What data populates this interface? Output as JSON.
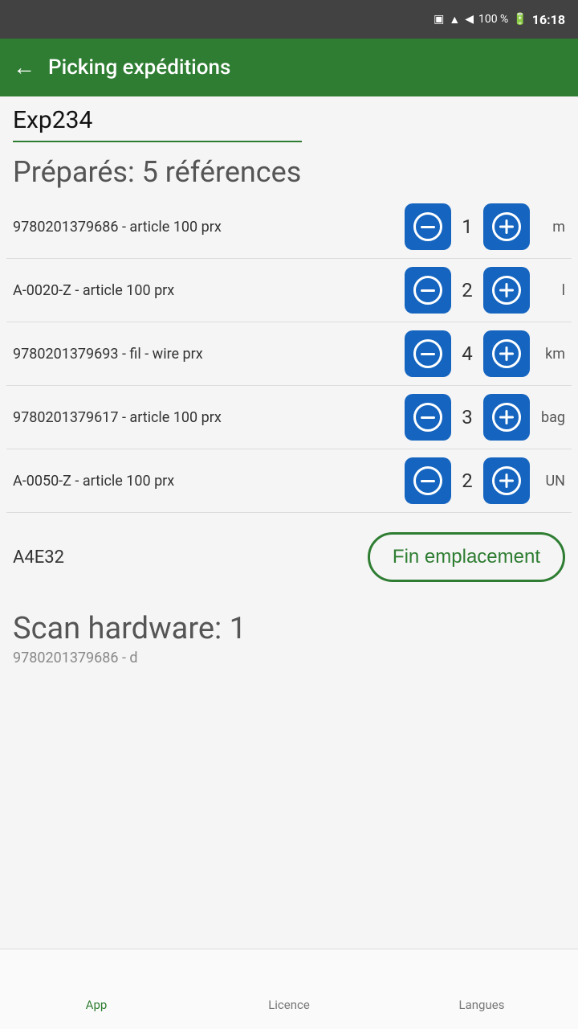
{
  "statusBar": {
    "battery": "100 %",
    "time": "16:18"
  },
  "header": {
    "backLabel": "←",
    "title": "Picking expéditions"
  },
  "expeditionId": "Exp234",
  "preparesTitle": "Préparés: 5 références",
  "items": [
    {
      "id": "item-1",
      "label": "9780201379686 - article 100 prx",
      "qty": 1,
      "unit": "m"
    },
    {
      "id": "item-2",
      "label": "A-0020-Z - article 100 prx",
      "qty": 2,
      "unit": "l"
    },
    {
      "id": "item-3",
      "label": "9780201379693 - fil - wire prx",
      "qty": 4,
      "unit": "km"
    },
    {
      "id": "item-4",
      "label": "9780201379617 - article 100 prx",
      "qty": 3,
      "unit": "bag"
    },
    {
      "id": "item-5",
      "label": "A-0050-Z - article 100 prx",
      "qty": 2,
      "unit": "UN"
    }
  ],
  "locationLabel": "A4E32",
  "finButton": "Fin emplacement",
  "scanTitle": "Scan hardware: 1",
  "scanSub": "9780201379686 - d",
  "bottomNav": {
    "items": [
      {
        "id": "nav-app",
        "label": "App",
        "active": true
      },
      {
        "id": "nav-licence",
        "label": "Licence",
        "active": false
      },
      {
        "id": "nav-langues",
        "label": "Langues",
        "active": false
      }
    ]
  }
}
